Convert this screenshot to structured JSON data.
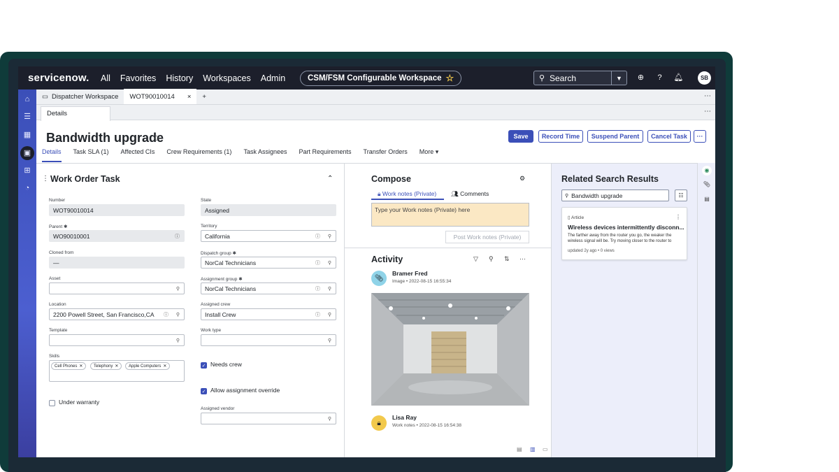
{
  "topnav": {
    "logo": "servicenow.",
    "items": [
      "All",
      "Favorites",
      "History",
      "Workspaces",
      "Admin"
    ],
    "workspace_pill": "CSM/FSM Configurable Workspace",
    "search_label": "Search",
    "avatar": "SB"
  },
  "tabs": {
    "workspace_tab": "Dispatcher Workspace",
    "record_tab": "WOT90010014",
    "add": "+",
    "close": "×",
    "subtab": "Details"
  },
  "record": {
    "title": "Bandwidth upgrade",
    "buttons": {
      "save": "Save",
      "record_time": "Record Time",
      "suspend_parent": "Suspend Parent",
      "cancel_task": "Cancel Task",
      "more": "···"
    },
    "tabs": [
      "Details",
      "Task SLA (1)",
      "Affected CIs",
      "Crew Requirements (1)",
      "Task Assignees",
      "Part Requirements",
      "Transfer Orders",
      "More ▾"
    ]
  },
  "form": {
    "title": "Work Order Task",
    "number_label": "Number",
    "number": "WOT90010014",
    "state_label": "State",
    "state": "Assigned",
    "parent_label": "Parent ✱",
    "parent": "WO90010001",
    "territory_label": "Territory",
    "territory": "California",
    "cloned_label": "Cloned from",
    "cloned": "—",
    "dispatch_label": "Dispatch group ✱",
    "dispatch": "NorCal Technicians",
    "asset_label": "Asset",
    "assign_group_label": "Assignment group ✱",
    "assign_group": "NorCal Technicians",
    "location_label": "Location",
    "location": "2200 Powell Street, San Francisco,CA",
    "crew_label": "Assigned crew",
    "crew": "Install Crew",
    "template_label": "Template",
    "worktype_label": "Work type",
    "skills_label": "Skills",
    "skills": [
      "Cell Phones",
      "Telephony",
      "Apple Computers"
    ],
    "needs_crew": "Needs crew",
    "allow_override": "Allow assignment override",
    "under_warranty": "Under warranty",
    "vendor_label": "Assigned vendor"
  },
  "compose": {
    "title": "Compose",
    "tab_work_notes": "Work notes (Private)",
    "tab_comments": "Comments",
    "placeholder": "Type your Work notes (Private) here",
    "post_button": "Post Work notes (Private)"
  },
  "activity": {
    "title": "Activity",
    "entries": [
      {
        "name": "Bramer Fred",
        "meta": "Image • 2022-08-15 16:55:34"
      },
      {
        "name": "Lisa Ray",
        "meta": "Work notes • 2022-08-15 16:54:38"
      }
    ]
  },
  "related": {
    "title": "Related Search Results",
    "search_value": "Bandwidth upgrade",
    "card": {
      "type": "Article",
      "title": "Wireless devices intermittently disconn...",
      "body": "The farther away from the router you go, the weaker the wireless signal will be. Try moving closer to the router to",
      "meta": "updated 2y ago • 0 views"
    }
  },
  "colors": {
    "accent": "#3b4fb8",
    "topnav": "#1c1f2b",
    "frame": "#0f3b3a"
  }
}
